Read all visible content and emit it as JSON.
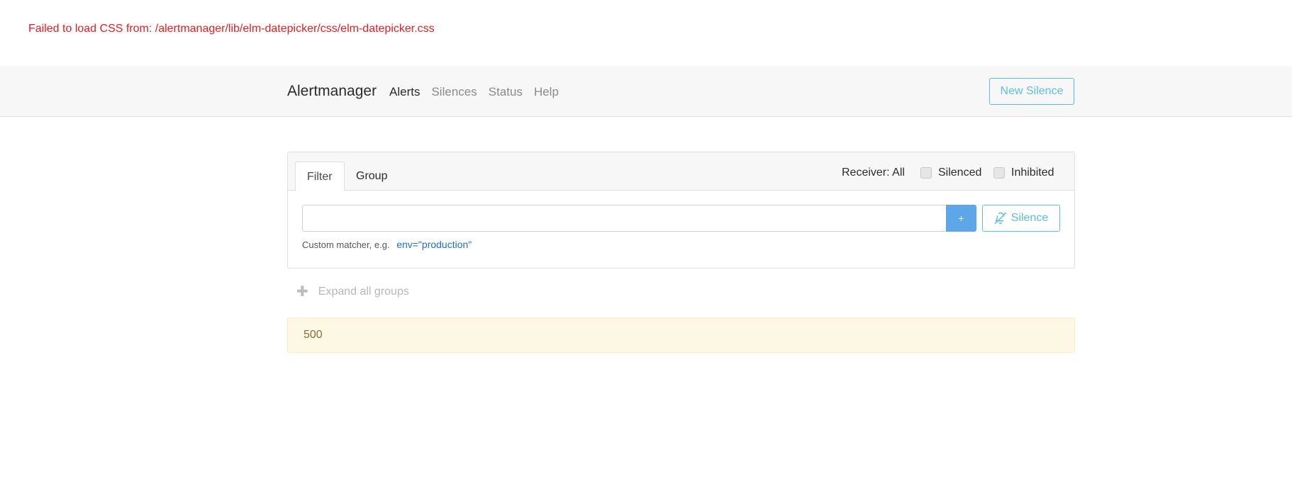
{
  "error_message": "Failed to load CSS from: /alertmanager/lib/elm-datepicker/css/elm-datepicker.css",
  "navbar": {
    "brand": "Alertmanager",
    "links": [
      "Alerts",
      "Silences",
      "Status",
      "Help"
    ],
    "active_link": "Alerts",
    "new_silence_label": "New Silence"
  },
  "filter_card": {
    "tabs": [
      "Filter",
      "Group"
    ],
    "active_tab": "Filter",
    "receiver_label": "Receiver: All",
    "silenced_label": "Silenced",
    "inhibited_label": "Inhibited",
    "silenced_checked": false,
    "inhibited_checked": false,
    "input_value": "",
    "add_button_label": "+",
    "silence_button_label": "Silence",
    "hint_text": "Custom matcher, e.g.",
    "hint_example": "env=\"production\""
  },
  "expand_all_label": "Expand all groups",
  "status_message": "500",
  "colors": {
    "error": "#e02020",
    "info": "#5bc0de",
    "primary": "#5da7e8",
    "warning_bg": "#fcf8e3"
  },
  "icons": {
    "add": "plus-icon",
    "silence": "bell-slash-icon",
    "expand": "plus-icon"
  }
}
